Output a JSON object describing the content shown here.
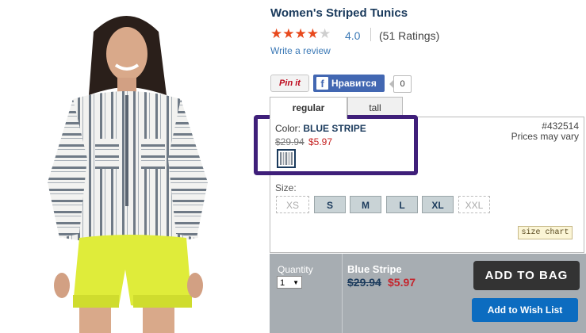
{
  "product": {
    "title": "Women's Striped Tunics",
    "rating_value": "4.0",
    "rating_stars": 4,
    "rating_count": "(51 Ratings)",
    "write_review": "Write a review"
  },
  "social": {
    "pinit_label": "Pin it",
    "facebook_label": "Нравится",
    "facebook_count": "0"
  },
  "tabs": [
    {
      "label": "regular",
      "active": true
    },
    {
      "label": "tall",
      "active": false
    }
  ],
  "color": {
    "label": "Color:",
    "name": "BLUE STRIPE",
    "original_price": "$29.94",
    "sale_price": "$5.97"
  },
  "sku": {
    "number": "#432514",
    "note": "Prices may vary"
  },
  "sizes": {
    "label": "Size:",
    "options": [
      {
        "label": "XS",
        "available": false
      },
      {
        "label": "S",
        "available": true
      },
      {
        "label": "M",
        "available": true
      },
      {
        "label": "L",
        "available": true
      },
      {
        "label": "XL",
        "available": true
      },
      {
        "label": "XXL",
        "available": false
      }
    ],
    "chart_label": "size chart"
  },
  "purchase": {
    "quantity_label": "Quantity",
    "quantity_value": "1",
    "item_name": "Blue Stripe",
    "original_price": "$29.94",
    "sale_price": "$5.97",
    "add_to_bag": "ADD TO BAG",
    "add_to_wishlist": "Add to Wish List"
  },
  "colors": {
    "title": "#1a3a5c",
    "star": "#e8491d",
    "link": "#3b79b6",
    "sale": "#c4262e",
    "highlight": "#3f1f7a",
    "bag_button": "#333333",
    "wish_button": "#0c6cc0",
    "bar_background": "#a7adb2"
  }
}
